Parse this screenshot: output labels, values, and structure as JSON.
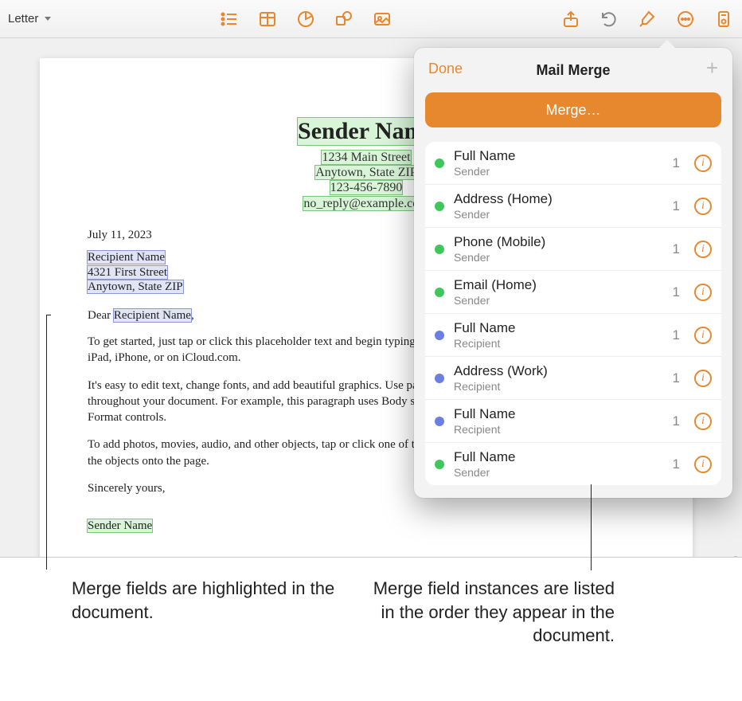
{
  "toolbar": {
    "doc_label": "Letter"
  },
  "document": {
    "sender_name": "Sender Name",
    "sender_street": "1234 Main Street",
    "sender_citystate": "Anytown, State ZIP",
    "sender_phone": "123-456-7890",
    "sender_email": "no_reply@example.com",
    "date": "July 11, 2023",
    "recipient_name": "Recipient Name",
    "recipient_street": "4321 First Street",
    "recipient_citystate": "Anytown, State ZIP",
    "greeting_prefix": "Dear ",
    "greeting_name": "Recipient Name",
    "greeting_suffix": ",",
    "para1": "To get started, just tap or click this placeholder text and begin typing. You can edit this document on your Mac, iPad, iPhone, or on iCloud.com.",
    "para2": "It's easy to edit text, change fonts, and add beautiful graphics. Use paragraph styles to get a consistent look throughout your document. For example, this paragraph uses Body style. You can change it in the Text tab of the Format controls.",
    "para3": "To add photos, movies, audio, and other objects, tap or click one of the insert buttons in the toolbar or drag and drop the objects onto the page.",
    "signoff": "Sincerely yours,",
    "signature_name": "Sender Name"
  },
  "popover": {
    "done": "Done",
    "title": "Mail Merge",
    "merge_button": "Merge…",
    "add_tooltip": "Add",
    "rows": [
      {
        "title": "Full Name",
        "sub": "Sender",
        "count": 1,
        "color": "green"
      },
      {
        "title": "Address (Home)",
        "sub": "Sender",
        "count": 1,
        "color": "green"
      },
      {
        "title": "Phone (Mobile)",
        "sub": "Sender",
        "count": 1,
        "color": "green"
      },
      {
        "title": "Email (Home)",
        "sub": "Sender",
        "count": 1,
        "color": "green"
      },
      {
        "title": "Full Name",
        "sub": "Recipient",
        "count": 1,
        "color": "blue"
      },
      {
        "title": "Address (Work)",
        "sub": "Recipient",
        "count": 1,
        "color": "blue"
      },
      {
        "title": "Full Name",
        "sub": "Recipient",
        "count": 1,
        "color": "blue"
      },
      {
        "title": "Full Name",
        "sub": "Sender",
        "count": 1,
        "color": "green"
      }
    ]
  },
  "callouts": {
    "left": "Merge fields are highlighted in the document.",
    "right": "Merge field instances are listed in the order they appear in the document."
  }
}
